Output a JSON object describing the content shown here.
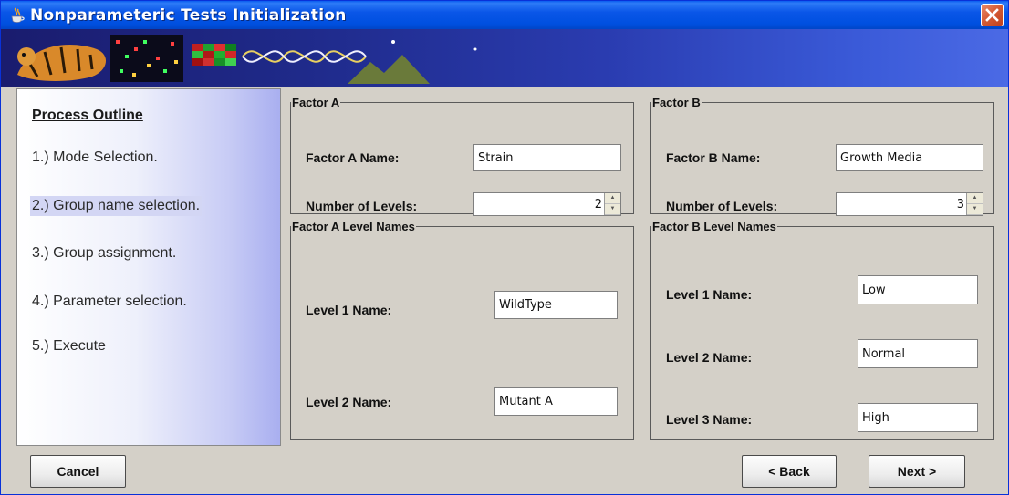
{
  "window": {
    "title": "Nonparameteric Tests Initialization"
  },
  "colors": {
    "titlebar": "#0050e0",
    "close": "#d45a34",
    "active_item": "#d3d6f4"
  },
  "outline": {
    "title": "Process Outline",
    "items": [
      {
        "label": "1.) Mode Selection."
      },
      {
        "label": "2.) Group name selection."
      },
      {
        "label": "3.) Group assignment."
      },
      {
        "label": "4.) Parameter selection."
      },
      {
        "label": "5.) Execute"
      }
    ],
    "active_index": 1
  },
  "factor_a": {
    "legend": "Factor A",
    "name_label": "Factor A Name:",
    "name_value": "Strain",
    "levels_label": "Number of Levels:",
    "levels_value": "2"
  },
  "factor_b": {
    "legend": "Factor B",
    "name_label": "Factor B Name:",
    "name_value": "Growth Media",
    "levels_label": "Number of Levels:",
    "levels_value": "3"
  },
  "factor_a_levels": {
    "legend": "Factor A Level Names",
    "levels": [
      {
        "label": "Level 1 Name:",
        "value": "WildType"
      },
      {
        "label": "Level 2 Name:",
        "value": "Mutant A"
      }
    ]
  },
  "factor_b_levels": {
    "legend": "Factor B Level Names",
    "levels": [
      {
        "label": "Level 1 Name:",
        "value": "Low"
      },
      {
        "label": "Level 2 Name:",
        "value": "Normal"
      },
      {
        "label": "Level 3 Name:",
        "value": "High"
      }
    ]
  },
  "buttons": {
    "cancel": "Cancel",
    "back": "< Back",
    "next": "Next >"
  }
}
